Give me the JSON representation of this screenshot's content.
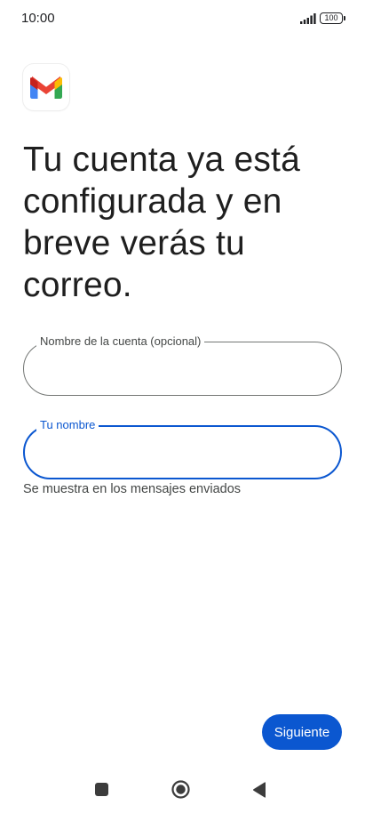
{
  "status_bar": {
    "time": "10:00",
    "battery": "100"
  },
  "app": {
    "logo": "gmail-logo-icon"
  },
  "main": {
    "title": "Tu cuenta ya está configurada y en breve verás tu correo.",
    "account_field": {
      "label": "Nombre de la cuenta (opcional)",
      "value": ""
    },
    "name_field": {
      "label": "Tu nombre",
      "value": "",
      "helper": "Se muestra en los mensajes enviados"
    },
    "next_label": "Siguiente"
  },
  "nav_bar": {
    "icons": [
      "recents-icon",
      "home-icon",
      "back-icon"
    ]
  },
  "colors": {
    "accent": "#0b57d0",
    "outline": "#747775",
    "text": "#1f1f1f"
  }
}
